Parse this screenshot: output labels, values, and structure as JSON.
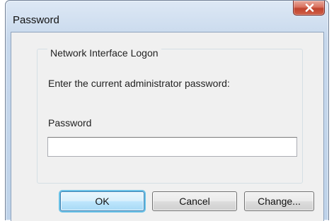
{
  "window": {
    "title": "Password"
  },
  "group": {
    "legend": "Network Interface Logon",
    "prompt": "Enter the current administrator password:",
    "password_label": "Password",
    "password_value": ""
  },
  "buttons": {
    "ok": "OK",
    "cancel": "Cancel",
    "change": "Change..."
  },
  "icons": {
    "close": "close-icon"
  },
  "colors": {
    "close_button": "#c0442f",
    "default_button_glow": "#6cc3e8",
    "window_frame": "#bfd3ea",
    "dialog_background": "#f0f0f0"
  }
}
